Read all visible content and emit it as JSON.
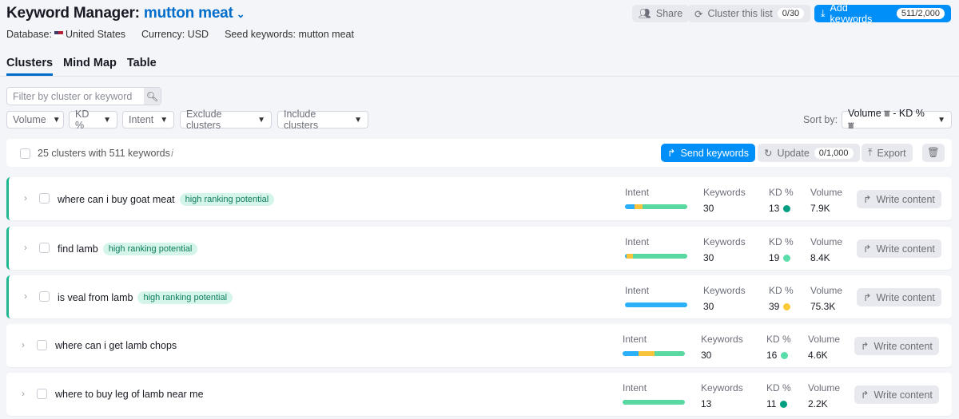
{
  "header": {
    "title_prefix": "Keyword Manager:",
    "list_name": "mutton meat",
    "database_label": "Database:",
    "database_value": "United States",
    "currency": "Currency: USD",
    "seed": "Seed keywords: mutton meat"
  },
  "actions": {
    "share": "Share",
    "cluster": "Cluster this list",
    "cluster_count": "0/30",
    "add": "Add keywords",
    "add_count": "511/2,000"
  },
  "tabs": [
    {
      "label": "Clusters",
      "active": true
    },
    {
      "label": "Mind Map"
    },
    {
      "label": "Table"
    }
  ],
  "filters": {
    "search_placeholder": "Filter by cluster or keyword",
    "volume": "Volume",
    "kd": "KD %",
    "intent": "Intent",
    "exclude": "Exclude clusters",
    "include": "Include clusters",
    "sort_label": "Sort by:",
    "sort_value": "Volume ⩸ - KD % ⩸"
  },
  "toolbar": {
    "summary": "25 clusters with 511 keywords",
    "send": "Send keywords",
    "update": "Update",
    "update_count": "0/1,000",
    "export": "Export"
  },
  "colors": {
    "informational": "#2bb0f8",
    "commercial": "#f8c33d",
    "transactional": "#59d8a1",
    "kd_easy": "#009f81",
    "kd_possible": "#59dda9",
    "kd_medium": "#fcca36",
    "accent": "#008ff8"
  },
  "labels": {
    "intent": "Intent",
    "keywords": "Keywords",
    "kd": "KD %",
    "volume": "Volume",
    "write": "Write content",
    "badge": "high ranking potential"
  },
  "clusters": [
    {
      "name": "where can i buy goat meat",
      "high_potential": true,
      "intent": [
        0.15,
        0.13,
        0.72
      ],
      "keywords": "30",
      "kd": "13",
      "kd_color": "#009f81",
      "volume": "7.9K"
    },
    {
      "name": "find lamb",
      "high_potential": true,
      "intent": [
        0.02,
        0.11,
        0.87
      ],
      "keywords": "30",
      "kd": "19",
      "kd_color": "#59dda9",
      "volume": "8.4K"
    },
    {
      "name": "is veal from lamb",
      "high_potential": true,
      "intent": [
        1,
        0,
        0
      ],
      "keywords": "30",
      "kd": "39",
      "kd_color": "#fcca36",
      "volume": "75.3K"
    },
    {
      "name": "where can i get lamb chops",
      "high_potential": false,
      "intent": [
        0.25,
        0.26,
        0.49
      ],
      "keywords": "30",
      "kd": "16",
      "kd_color": "#59dda9",
      "volume": "4.6K"
    },
    {
      "name": "where to buy leg of lamb near me",
      "high_potential": false,
      "intent": [
        0,
        0,
        1
      ],
      "keywords": "13",
      "kd": "11",
      "kd_color": "#009f81",
      "volume": "2.2K"
    }
  ]
}
